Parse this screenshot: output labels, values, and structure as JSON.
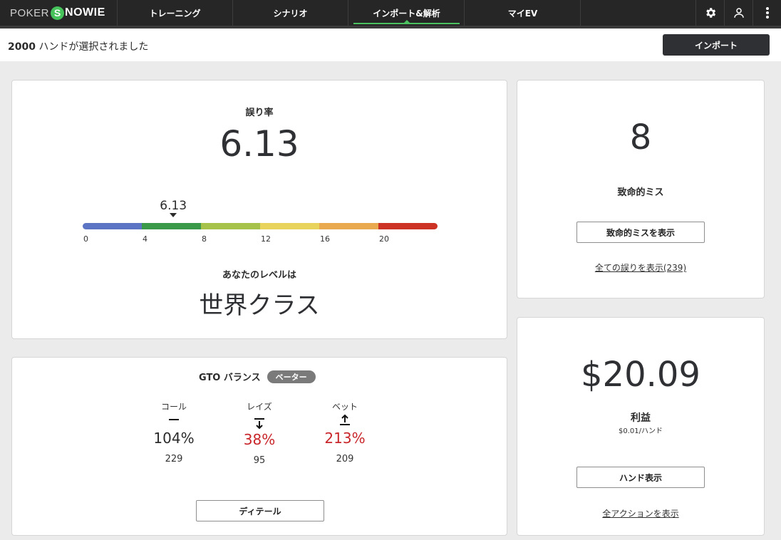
{
  "logo": {
    "poker": "POKER",
    "s_letter": "S",
    "nowie": "NOWIE"
  },
  "nav": {
    "tabs": [
      "トレーニング",
      "シナリオ",
      "インポート&解析",
      "マイEV"
    ],
    "active_index": 2
  },
  "icons": {
    "settings": "gear-icon",
    "profile": "user-icon",
    "menu": "kebab-menu-icon"
  },
  "header": {
    "hand_count": "2000",
    "selected_suffix": " ハンドが選択されました",
    "import_button": "インポート"
  },
  "error_card": {
    "label": "誤り率",
    "value": "6.13",
    "marker_value": 6.13,
    "marker_label": "6.13",
    "scale_max": 24,
    "ticks": [
      "0",
      "4",
      "8",
      "12",
      "16",
      "20"
    ],
    "segments": [
      {
        "color": "#5b74c4"
      },
      {
        "color": "#3a9a4a"
      },
      {
        "color": "#a6c24a"
      },
      {
        "color": "#e8d35c"
      },
      {
        "color": "#e8a94f"
      },
      {
        "color": "#cc3325"
      }
    ],
    "level_label": "あなたのレベルは",
    "level_value": "世界クラス"
  },
  "gto_card": {
    "title": "GTO バランス",
    "badge": "ベーター",
    "columns": [
      {
        "label": "コール",
        "icon": "dash-icon",
        "percent": "104%",
        "count": "229",
        "color": "#2b2b2b"
      },
      {
        "label": "レイズ",
        "icon": "arrow-down-icon",
        "percent": "38%",
        "count": "95",
        "color": "#c8262a"
      },
      {
        "label": "ベット",
        "icon": "arrow-up-icon",
        "percent": "213%",
        "count": "209",
        "color": "#c8262a"
      }
    ],
    "details_button": "ディテール"
  },
  "blunder_card": {
    "value": "8",
    "label": "致命的ミス",
    "button": "致命的ミスを表示",
    "link": "全ての誤りを表示(239)"
  },
  "profit_card": {
    "value": "$20.09",
    "label": "利益",
    "per_hand": "$0.01/ハンド",
    "button": "ハンド表示",
    "link": "全アクションを表示"
  }
}
